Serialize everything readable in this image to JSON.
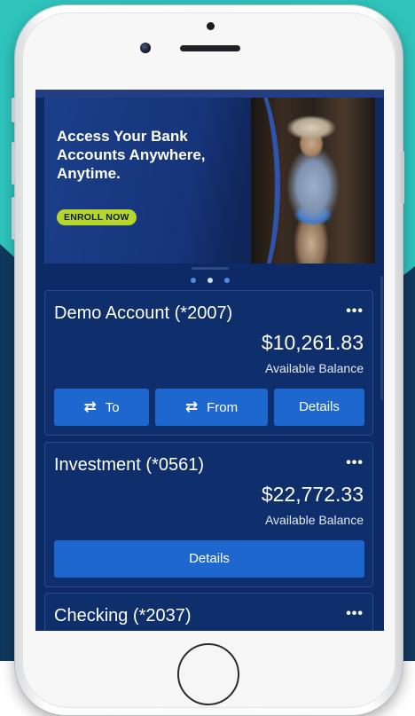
{
  "banner": {
    "headline": "Access Your Bank Accounts Anywhere, Anytime.",
    "cta_label": "ENROLL NOW"
  },
  "carousel": {
    "dots": 3,
    "active_index": 1
  },
  "accounts": [
    {
      "name": "Demo Account (*2007)",
      "balance": "$10,261.83",
      "balance_label": "Available Balance",
      "more_label": "•••",
      "actions": [
        {
          "label": "To",
          "icon": "transfer-arrows-icon"
        },
        {
          "label": "From",
          "icon": "transfer-arrows-icon"
        },
        {
          "label": "Details"
        }
      ]
    },
    {
      "name": "Investment (*0561)",
      "balance": "$22,772.33",
      "balance_label": "Available Balance",
      "more_label": "•••",
      "actions": [
        {
          "label": "Details"
        }
      ]
    },
    {
      "name": "Checking (*2037)",
      "more_label": "•••"
    }
  ],
  "colors": {
    "screen_bg": "#0d2a66",
    "card_bg": "#0f2e6c",
    "button_blue": "#1e67cf",
    "enroll_green": "#b6d62b",
    "backdrop_teal": "#2ec4bc",
    "backdrop_navy": "#10395e"
  }
}
